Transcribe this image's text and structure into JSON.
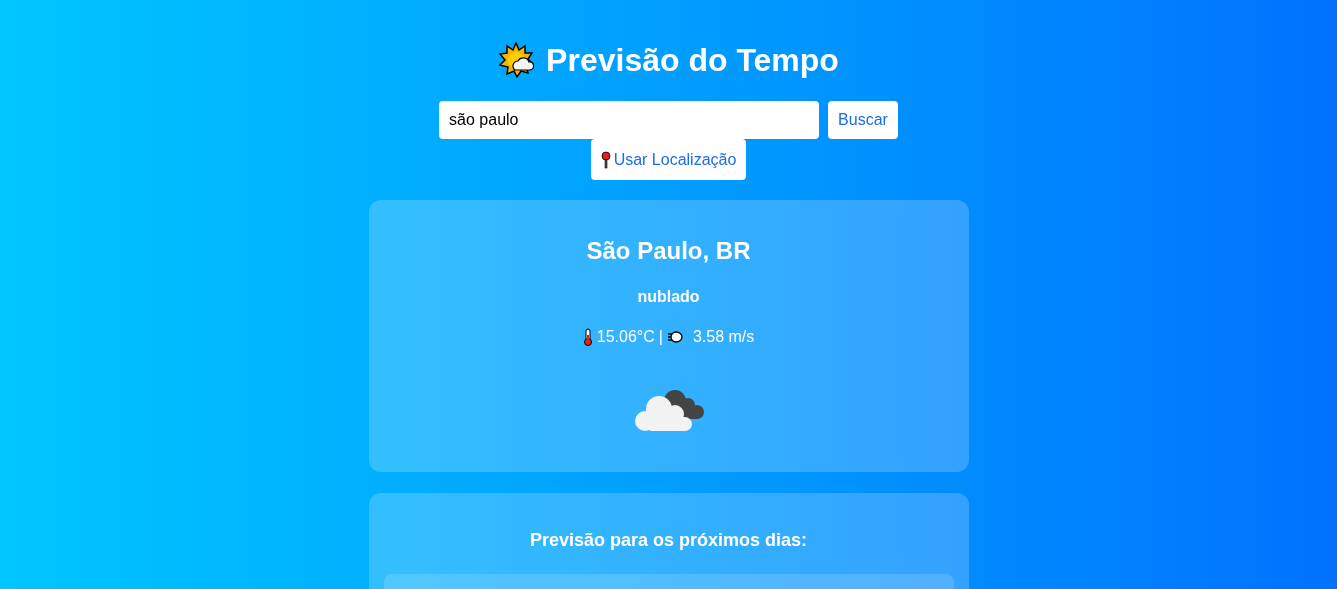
{
  "title": "Previsão do Tempo",
  "search": {
    "value": "são paulo",
    "button": "Buscar"
  },
  "location_button": "Usar Localização",
  "current": {
    "city": "São Paulo, BR",
    "description": "nublado",
    "temperature": "15.06°C",
    "separator": "|",
    "wind": "3.58 m/s"
  },
  "forecast": {
    "heading": "Previsão para os próximos dias:"
  }
}
